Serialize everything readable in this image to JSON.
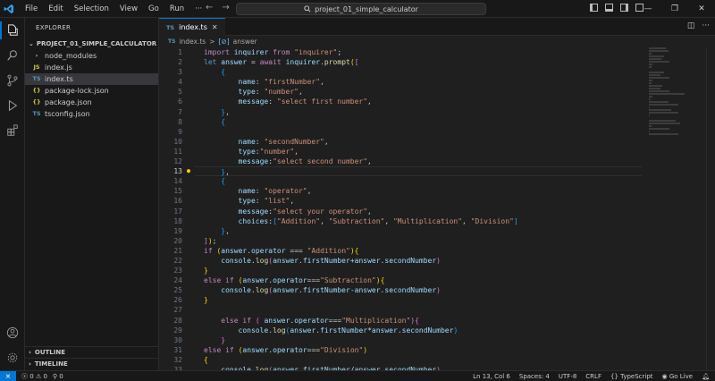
{
  "titlebar": {
    "menu": [
      "File",
      "Edit",
      "Selection",
      "View",
      "Go",
      "Run",
      "···"
    ],
    "command_center": "project_01_simple_calculator",
    "nav_back": "←",
    "nav_forward": "→"
  },
  "sidebar": {
    "header": "EXPLORER",
    "folder": "PROJECT_01_SIMPLE_CALCULATOR",
    "items": [
      {
        "name": "node_modules",
        "icon": "›",
        "icon_color": "#cccccc"
      },
      {
        "name": "index.js",
        "icon": "JS",
        "icon_color": "#cbcb41"
      },
      {
        "name": "index.ts",
        "icon": "TS",
        "icon_color": "#519aba"
      },
      {
        "name": "package-lock.json",
        "icon": "{}",
        "icon_color": "#cbcb41"
      },
      {
        "name": "package.json",
        "icon": "{}",
        "icon_color": "#cbcb41"
      },
      {
        "name": "tsconfig.json",
        "icon": "TS",
        "icon_color": "#519aba"
      }
    ],
    "outline": "OUTLINE",
    "timeline": "TIMELINE"
  },
  "editor": {
    "tab": {
      "label": "index.ts",
      "icon": "TS"
    },
    "breadcrumb": {
      "file": "index.ts",
      "symbol": "answer",
      "sep": ">"
    },
    "current_line": 13
  },
  "statusbar": {
    "errors": "0",
    "warnings": "0",
    "ports": "0",
    "position": "Ln 13, Col 6",
    "spaces": "Spaces: 4",
    "encoding": "UTF-8",
    "eol": "CRLF",
    "language": "TypeScript",
    "golive": "Go Live"
  },
  "colors": {
    "accent": "#0078d4",
    "keyword": "#c586c0",
    "string": "#ce9178",
    "variable": "#9cdcfe",
    "function": "#dcdcaa"
  },
  "code_lines": [
    [
      [
        "kw",
        "import"
      ],
      [
        "pu",
        " "
      ],
      [
        "var",
        "inquirer"
      ],
      [
        "pu",
        " "
      ],
      [
        "kw",
        "from"
      ],
      [
        "pu",
        " "
      ],
      [
        "str",
        "\"inquirer\""
      ],
      [
        "pu",
        ";"
      ]
    ],
    [
      [
        "kb",
        "let"
      ],
      [
        "pu",
        " "
      ],
      [
        "var",
        "answer"
      ],
      [
        "pu",
        " = "
      ],
      [
        "kw",
        "await"
      ],
      [
        "pu",
        " "
      ],
      [
        "var",
        "inquirer"
      ],
      [
        "pu",
        "."
      ],
      [
        "fn",
        "prompt"
      ],
      [
        "br1",
        "("
      ],
      [
        "br2",
        "["
      ]
    ],
    [
      [
        "pu",
        "    "
      ],
      [
        "br3",
        "{"
      ]
    ],
    [
      [
        "pu",
        "        "
      ],
      [
        "var",
        "name"
      ],
      [
        "pu",
        ": "
      ],
      [
        "str",
        "\"firstNumber\""
      ],
      [
        "pu",
        ","
      ]
    ],
    [
      [
        "pu",
        "        "
      ],
      [
        "var",
        "type"
      ],
      [
        "pu",
        ": "
      ],
      [
        "str",
        "\"number\""
      ],
      [
        "pu",
        ","
      ]
    ],
    [
      [
        "pu",
        "        "
      ],
      [
        "var",
        "message"
      ],
      [
        "pu",
        ": "
      ],
      [
        "str",
        "\"select first number\""
      ],
      [
        "pu",
        ","
      ]
    ],
    [
      [
        "pu",
        "    "
      ],
      [
        "br3",
        "}"
      ],
      [
        "pu",
        ","
      ]
    ],
    [
      [
        "pu",
        "    "
      ],
      [
        "br3",
        "{"
      ]
    ],
    [
      [
        "pu",
        ""
      ]
    ],
    [
      [
        "pu",
        "        "
      ],
      [
        "var",
        "name"
      ],
      [
        "pu",
        ": "
      ],
      [
        "str",
        "\"secondNumber\""
      ],
      [
        "pu",
        ","
      ]
    ],
    [
      [
        "pu",
        "        "
      ],
      [
        "var",
        "type"
      ],
      [
        "pu",
        ":"
      ],
      [
        "str",
        "\"number\""
      ],
      [
        "pu",
        ","
      ]
    ],
    [
      [
        "pu",
        "        "
      ],
      [
        "var",
        "message"
      ],
      [
        "pu",
        ":"
      ],
      [
        "str",
        "\"select second number\""
      ],
      [
        "pu",
        ","
      ]
    ],
    [
      [
        "pu",
        "    "
      ],
      [
        "br3",
        "}"
      ],
      [
        "pu",
        ","
      ]
    ],
    [
      [
        "pu",
        "    "
      ],
      [
        "br3",
        "{"
      ]
    ],
    [
      [
        "pu",
        "        "
      ],
      [
        "var",
        "name"
      ],
      [
        "pu",
        ": "
      ],
      [
        "str",
        "\"operator\""
      ],
      [
        "pu",
        ","
      ]
    ],
    [
      [
        "pu",
        "        "
      ],
      [
        "var",
        "type"
      ],
      [
        "pu",
        ": "
      ],
      [
        "str",
        "\"list\""
      ],
      [
        "pu",
        ","
      ]
    ],
    [
      [
        "pu",
        "        "
      ],
      [
        "var",
        "message"
      ],
      [
        "pu",
        ":"
      ],
      [
        "str",
        "\"select your operator\""
      ],
      [
        "pu",
        ","
      ]
    ],
    [
      [
        "pu",
        "        "
      ],
      [
        "var",
        "choices"
      ],
      [
        "pu",
        ":"
      ],
      [
        "br3",
        "["
      ],
      [
        "str",
        "\"Addition\""
      ],
      [
        "pu",
        ", "
      ],
      [
        "str",
        "\"Subtraction\""
      ],
      [
        "pu",
        ", "
      ],
      [
        "str",
        "\"Multiplication\""
      ],
      [
        "pu",
        ", "
      ],
      [
        "str",
        "\"Division\""
      ],
      [
        "br3",
        "]"
      ]
    ],
    [
      [
        "pu",
        "    "
      ],
      [
        "br3",
        "}"
      ],
      [
        "pu",
        ","
      ]
    ],
    [
      [
        "br2",
        "]"
      ],
      [
        "br1",
        ")"
      ],
      [
        "pu",
        ";"
      ]
    ],
    [
      [
        "kw",
        "if"
      ],
      [
        "pu",
        " "
      ],
      [
        "br1",
        "("
      ],
      [
        "var",
        "answer"
      ],
      [
        "pu",
        "."
      ],
      [
        "var",
        "operator"
      ],
      [
        "pu",
        " === "
      ],
      [
        "str",
        "\"Addition\""
      ],
      [
        "br1",
        ")"
      ],
      [
        "br1",
        "{"
      ]
    ],
    [
      [
        "pu",
        "    "
      ],
      [
        "var",
        "console"
      ],
      [
        "pu",
        "."
      ],
      [
        "fn",
        "log"
      ],
      [
        "br2",
        "("
      ],
      [
        "var",
        "answer"
      ],
      [
        "pu",
        "."
      ],
      [
        "var",
        "firstNumber"
      ],
      [
        "pu",
        "+"
      ],
      [
        "var",
        "answer"
      ],
      [
        "pu",
        "."
      ],
      [
        "var",
        "secondNumber"
      ],
      [
        "br2",
        ")"
      ]
    ],
    [
      [
        "br1",
        "}"
      ]
    ],
    [
      [
        "kw",
        "else"
      ],
      [
        "pu",
        " "
      ],
      [
        "kw",
        "if"
      ],
      [
        "pu",
        " "
      ],
      [
        "br1",
        "("
      ],
      [
        "var",
        "answer"
      ],
      [
        "pu",
        "."
      ],
      [
        "var",
        "operator"
      ],
      [
        "pu",
        "==="
      ],
      [
        "str",
        "\"Subtraction\""
      ],
      [
        "br1",
        ")"
      ],
      [
        "br1",
        "{"
      ]
    ],
    [
      [
        "pu",
        "    "
      ],
      [
        "var",
        "console"
      ],
      [
        "pu",
        "."
      ],
      [
        "fn",
        "log"
      ],
      [
        "br2",
        "("
      ],
      [
        "var",
        "answer"
      ],
      [
        "pu",
        "."
      ],
      [
        "var",
        "firstNumber"
      ],
      [
        "pu",
        "-"
      ],
      [
        "var",
        "answer"
      ],
      [
        "pu",
        "."
      ],
      [
        "var",
        "secondNumber"
      ],
      [
        "br2",
        ")"
      ]
    ],
    [
      [
        "br1",
        "}"
      ]
    ],
    [
      [
        "pu",
        ""
      ]
    ],
    [
      [
        "pu",
        "    "
      ],
      [
        "kw",
        "else"
      ],
      [
        "pu",
        " "
      ],
      [
        "kw",
        "if"
      ],
      [
        "pu",
        " "
      ],
      [
        "br2",
        "("
      ],
      [
        "pu",
        " "
      ],
      [
        "var",
        "answer"
      ],
      [
        "pu",
        "."
      ],
      [
        "var",
        "operator"
      ],
      [
        "pu",
        "==="
      ],
      [
        "str",
        "\"Multiplication\""
      ],
      [
        "br2",
        ")"
      ],
      [
        "br2",
        "{"
      ]
    ],
    [
      [
        "pu",
        "        "
      ],
      [
        "var",
        "console"
      ],
      [
        "pu",
        "."
      ],
      [
        "fn",
        "log"
      ],
      [
        "br3",
        "("
      ],
      [
        "var",
        "answer"
      ],
      [
        "pu",
        "."
      ],
      [
        "var",
        "firstNumber"
      ],
      [
        "pu",
        "*"
      ],
      [
        "var",
        "answer"
      ],
      [
        "pu",
        "."
      ],
      [
        "var",
        "secondNumber"
      ],
      [
        "br3",
        ")"
      ]
    ],
    [
      [
        "pu",
        "    "
      ],
      [
        "br2",
        "}"
      ]
    ],
    [
      [
        "kw",
        "else"
      ],
      [
        "pu",
        " "
      ],
      [
        "kw",
        "if"
      ],
      [
        "pu",
        " "
      ],
      [
        "br1",
        "("
      ],
      [
        "var",
        "answer"
      ],
      [
        "pu",
        "."
      ],
      [
        "var",
        "operator"
      ],
      [
        "pu",
        "==="
      ],
      [
        "str",
        "\"Division\""
      ],
      [
        "br1",
        ")"
      ]
    ],
    [
      [
        "br1",
        "{"
      ]
    ],
    [
      [
        "pu",
        "    "
      ],
      [
        "var",
        "console"
      ],
      [
        "pu",
        "."
      ],
      [
        "fn",
        "log"
      ],
      [
        "br2",
        "("
      ],
      [
        "var",
        "answer"
      ],
      [
        "pu",
        "."
      ],
      [
        "var",
        "firstNumber"
      ],
      [
        "pu",
        "/"
      ],
      [
        "var",
        "answer"
      ],
      [
        "pu",
        "."
      ],
      [
        "var",
        "secondNumber"
      ],
      [
        "br2",
        ")"
      ]
    ]
  ]
}
